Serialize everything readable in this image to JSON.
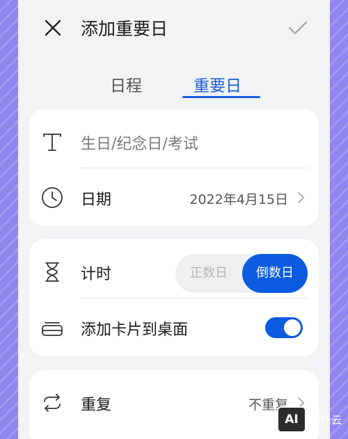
{
  "header": {
    "title": "添加重要日"
  },
  "tabs": [
    {
      "label": "日程",
      "active": false
    },
    {
      "label": "重要日",
      "active": true
    }
  ],
  "card1": {
    "name_placeholder": "生日/纪念日/考试",
    "date_label": "日期",
    "date_value": "2022年4月15日"
  },
  "card2": {
    "timing_label": "计时",
    "segment_options": [
      "正数日",
      "倒数日"
    ],
    "segment_selected": "倒数日",
    "widget_label": "添加卡片到桌面",
    "widget_enabled": true
  },
  "card3": {
    "repeat_label": "重复",
    "repeat_value": "不重复"
  },
  "watermark": {
    "logo_text": "AI",
    "text": "树叶云"
  },
  "colors": {
    "accent": "#0a5be0",
    "tab_active": "#1a5bd8",
    "background": "#f1f3f5"
  },
  "icons": {
    "close": "close-icon",
    "confirm": "check-icon",
    "text": "text-icon",
    "date": "clock-icon",
    "timing": "hourglass-icon",
    "widget": "card-stack-icon",
    "repeat": "repeat-icon"
  }
}
